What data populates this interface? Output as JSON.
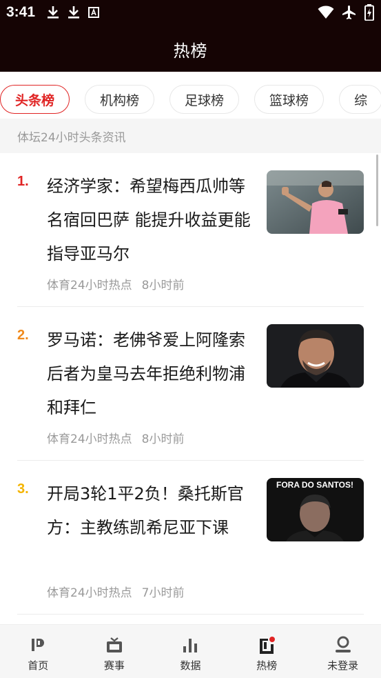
{
  "status_bar": {
    "time": "3:41",
    "left_icons": [
      "download-icon",
      "download-icon",
      "translate-icon"
    ],
    "right_icons": [
      "wifi-icon",
      "airplane-mode-icon",
      "battery-icon"
    ]
  },
  "app_bar": {
    "title": "热榜"
  },
  "tabs": [
    {
      "label": "头条榜",
      "active": true
    },
    {
      "label": "机构榜",
      "active": false
    },
    {
      "label": "足球榜",
      "active": false
    },
    {
      "label": "篮球榜",
      "active": false
    },
    {
      "label": "综",
      "active": false
    }
  ],
  "subheader": "体坛24小时头条资讯",
  "news": [
    {
      "rank": "1.",
      "rank_color": "#e02424",
      "title": "经济学家：希望梅西瓜帅等名宿回巴萨 能提升收益更能指导亚马尔",
      "source": "体育24小时热点",
      "time": "8小时前",
      "thumb_icon": "player-photo"
    },
    {
      "rank": "2.",
      "rank_color": "#f08a1c",
      "title": "罗马诺：老佛爷爱上阿隆索 后者为皇马去年拒绝利物浦和拜仁",
      "source": "体育24小时热点",
      "time": "8小时前",
      "thumb_icon": "coach-photo"
    },
    {
      "rank": "3.",
      "rank_color": "#f4b400",
      "title": "开局3轮1平2负！桑托斯官方：主教练凯希尼亚下课",
      "source": "体育24小时热点",
      "time": "7小时前",
      "thumb_icon": "coach-photo",
      "thumb_text": "FORA DO SANTOS!"
    }
  ],
  "bottom_nav": [
    {
      "label": "首页",
      "icon": "home-logo-icon"
    },
    {
      "label": "赛事",
      "icon": "tv-icon"
    },
    {
      "label": "数据",
      "icon": "bar-chart-icon"
    },
    {
      "label": "热榜",
      "icon": "hot-list-icon",
      "badge": true
    },
    {
      "label": "未登录",
      "icon": "user-icon"
    }
  ],
  "colors": {
    "accent": "#e02424",
    "bar_bg": "#150404"
  }
}
